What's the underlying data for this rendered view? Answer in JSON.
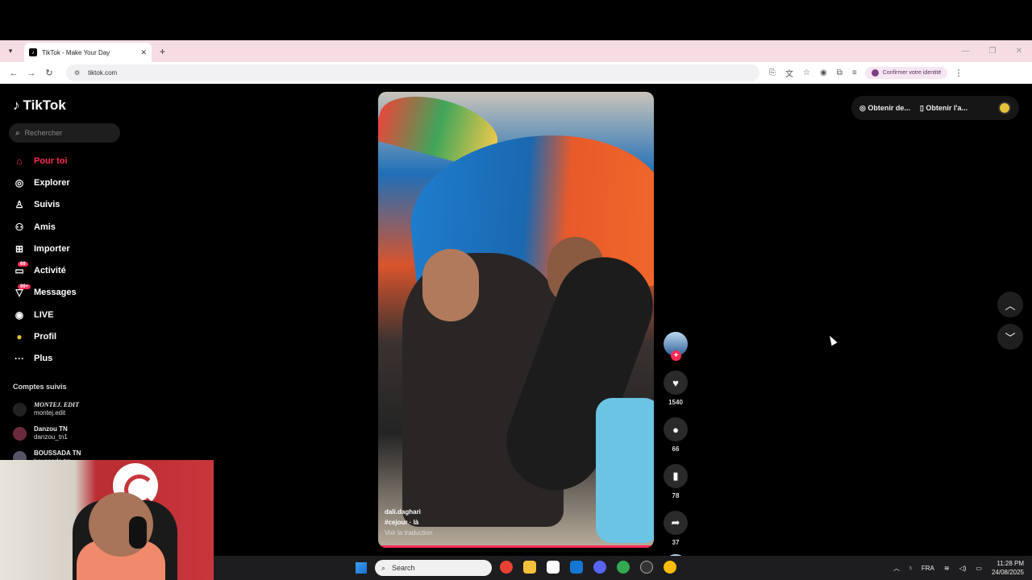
{
  "browser": {
    "tab_title": "TikTok - Make Your Day",
    "url": "tiktok.com",
    "identity_label": "Confirmer votre identité"
  },
  "tiktok": {
    "logo": "TikTok",
    "search_placeholder": "Rechercher",
    "nav": [
      {
        "label": "Pour toi",
        "icon": "home-icon",
        "active": true
      },
      {
        "label": "Explorer",
        "icon": "compass-icon"
      },
      {
        "label": "Suivis",
        "icon": "following-icon"
      },
      {
        "label": "Amis",
        "icon": "friends-icon"
      },
      {
        "label": "Importer",
        "icon": "upload-icon"
      },
      {
        "label": "Activité",
        "icon": "activity-icon",
        "badge": "69"
      },
      {
        "label": "Messages",
        "icon": "messages-icon",
        "badge": "99+"
      },
      {
        "label": "LIVE",
        "icon": "live-icon"
      },
      {
        "label": "Profil",
        "icon": "profile-icon"
      },
      {
        "label": "Plus",
        "icon": "more-icon"
      }
    ],
    "following_title": "Comptes suivis",
    "following": [
      {
        "display": "MONTEJ. EDIT",
        "user": "montej.edit"
      },
      {
        "display": "Danzou TN",
        "user": "danzou_tn1"
      },
      {
        "display": "BOUSSADA TN",
        "user": "boussada.tm"
      }
    ],
    "video": {
      "author": "dali.daghari",
      "hashtags": "#cejour · là",
      "translate": "Voir la traduction"
    },
    "actions": {
      "likes": "1540",
      "comments": "66",
      "saves": "78",
      "shares": "37"
    },
    "topright": {
      "coins": "Obtenir de...",
      "app": "Obtenir l'a..."
    }
  },
  "taskbar": {
    "search": "Search",
    "lang": "FRA",
    "time": "11:28 PM",
    "date": "24/08/2025"
  },
  "colors": {
    "accent": "#fe2c55",
    "tab_bar": "#f6dde4"
  }
}
